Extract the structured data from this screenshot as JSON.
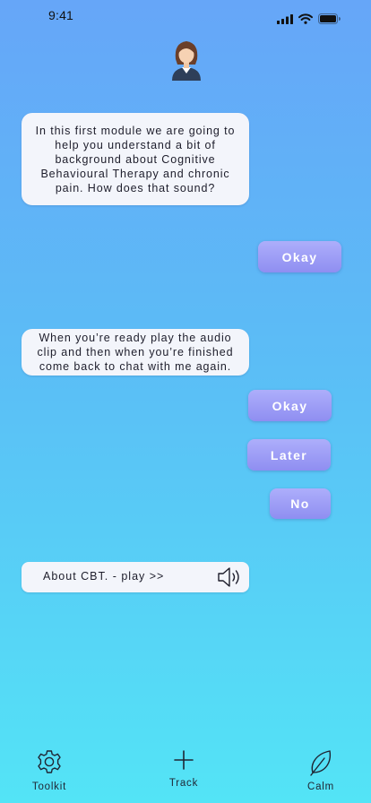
{
  "status_bar": {
    "time": "9:41",
    "icons": [
      "cellular-signal-icon",
      "wifi-icon",
      "battery-icon"
    ]
  },
  "chat": {
    "coach_avatar": "coach-avatar-icon",
    "messages": [
      {
        "from": "coach",
        "text": "In this first module we are going to help you understand a bit of background about Cognitive Behavioural Therapy and chronic pain. How does that sound?"
      },
      {
        "from": "coach",
        "text": "When you’re ready play the audio clip and then when you’re finished come back to chat with me again."
      }
    ],
    "replies": {
      "first_okay": "Okay",
      "second_okay": "Okay",
      "later": "Later",
      "no": "No"
    },
    "audio_clip": {
      "label": "About CBT. - play >>",
      "icon": "speaker-icon"
    }
  },
  "tab_bar": {
    "items": [
      {
        "label": "Toolkit",
        "icon": "gear-icon"
      },
      {
        "label": "Track",
        "icon": "plus-icon"
      },
      {
        "label": "Calm",
        "icon": "leaf-icon"
      }
    ]
  },
  "colors": {
    "background_top": "#66a6f8",
    "background_bottom": "#53e4f6",
    "bubble": "#f3f5fb",
    "reply_button": "#9c9cf6",
    "reply_text": "#ffffff"
  }
}
